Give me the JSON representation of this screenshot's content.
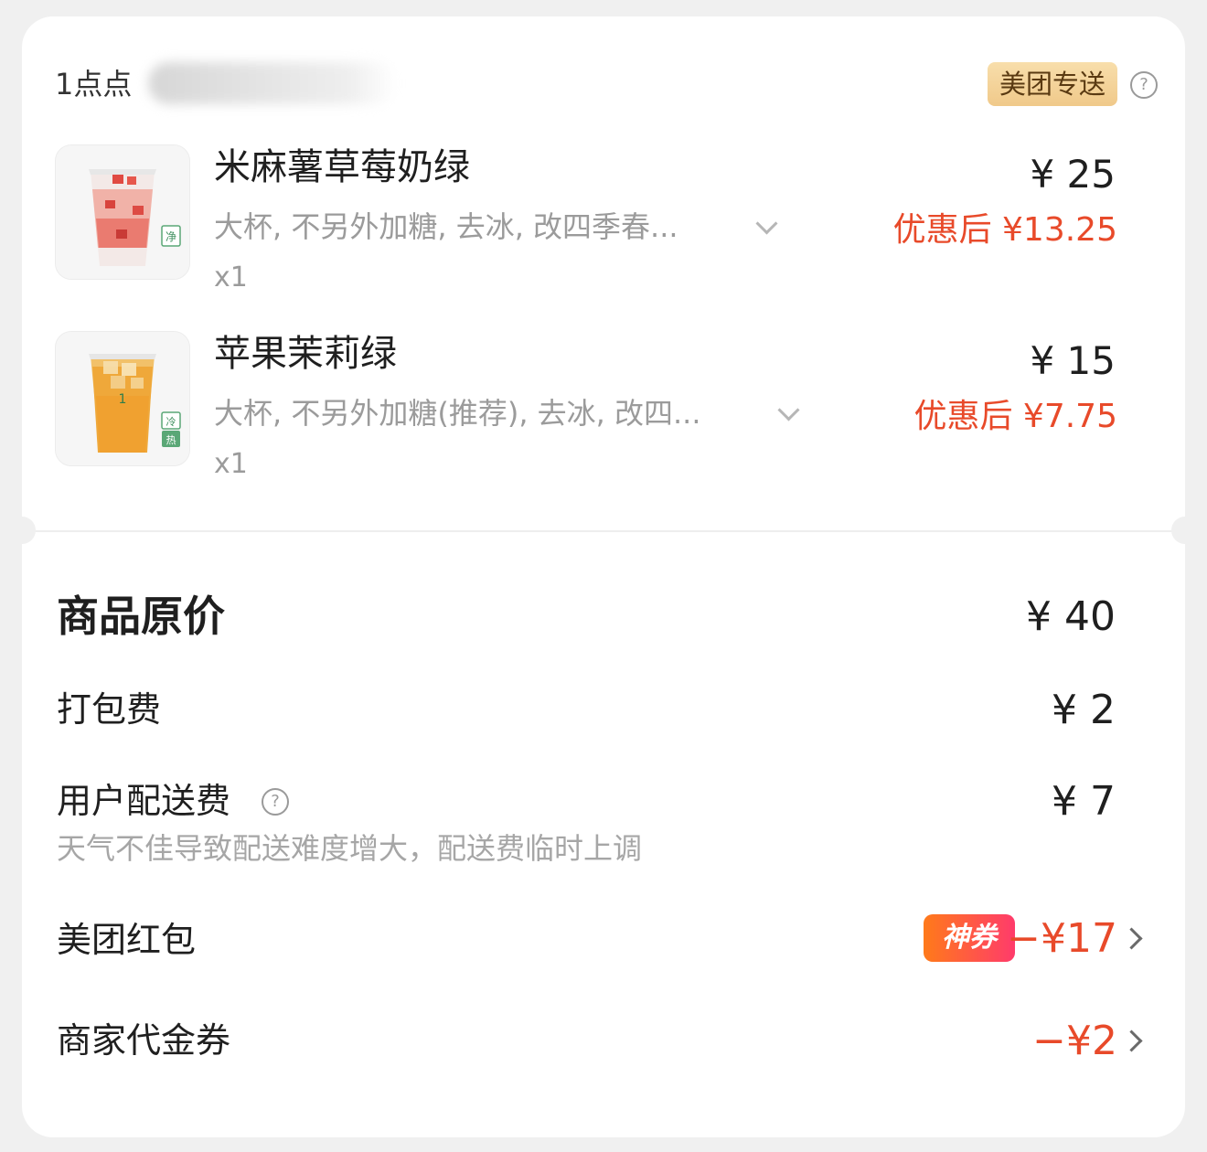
{
  "header": {
    "store_prefix": "1点点",
    "delivery_badge": "美团专送",
    "help_icon": "question-circle-icon"
  },
  "items": [
    {
      "title": "米麻薯草莓奶绿",
      "spec": "大杯, 不另外加糖, 去冰, 改四季春...",
      "qty": "x1",
      "price": "¥ 25",
      "discount_price": "优惠后 ¥13.25",
      "image": "strawberry-milk-green-tea-image",
      "tag": "冷"
    },
    {
      "title": "苹果茉莉绿",
      "spec": "大杯, 不另外加糖(推荐), 去冰, 改四...",
      "qty": "x1",
      "price": "¥ 15",
      "discount_price": "优惠后 ¥7.75",
      "image": "apple-jasmine-green-tea-image",
      "tags": [
        "冷",
        "热"
      ]
    }
  ],
  "summary": {
    "original_price_label": "商品原价",
    "original_price_value": "¥ 40",
    "packing_fee_label": "打包费",
    "packing_fee_value": "¥ 2",
    "delivery_fee_label": "用户配送费",
    "delivery_fee_value": "¥ 7",
    "delivery_fee_note": "天气不佳导致配送难度增大，配送费临时上调",
    "red_packet_label": "美团红包",
    "red_packet_badge": "神券",
    "red_packet_value": "−¥17",
    "merchant_voucher_label": "商家代金券",
    "merchant_voucher_value": "−¥2"
  },
  "colors": {
    "accent_red": "#e84a2a",
    "badge_gold": "#f0c98a",
    "coupon_gradient_start": "#ff7a1a",
    "coupon_gradient_end": "#ff3b6b"
  }
}
